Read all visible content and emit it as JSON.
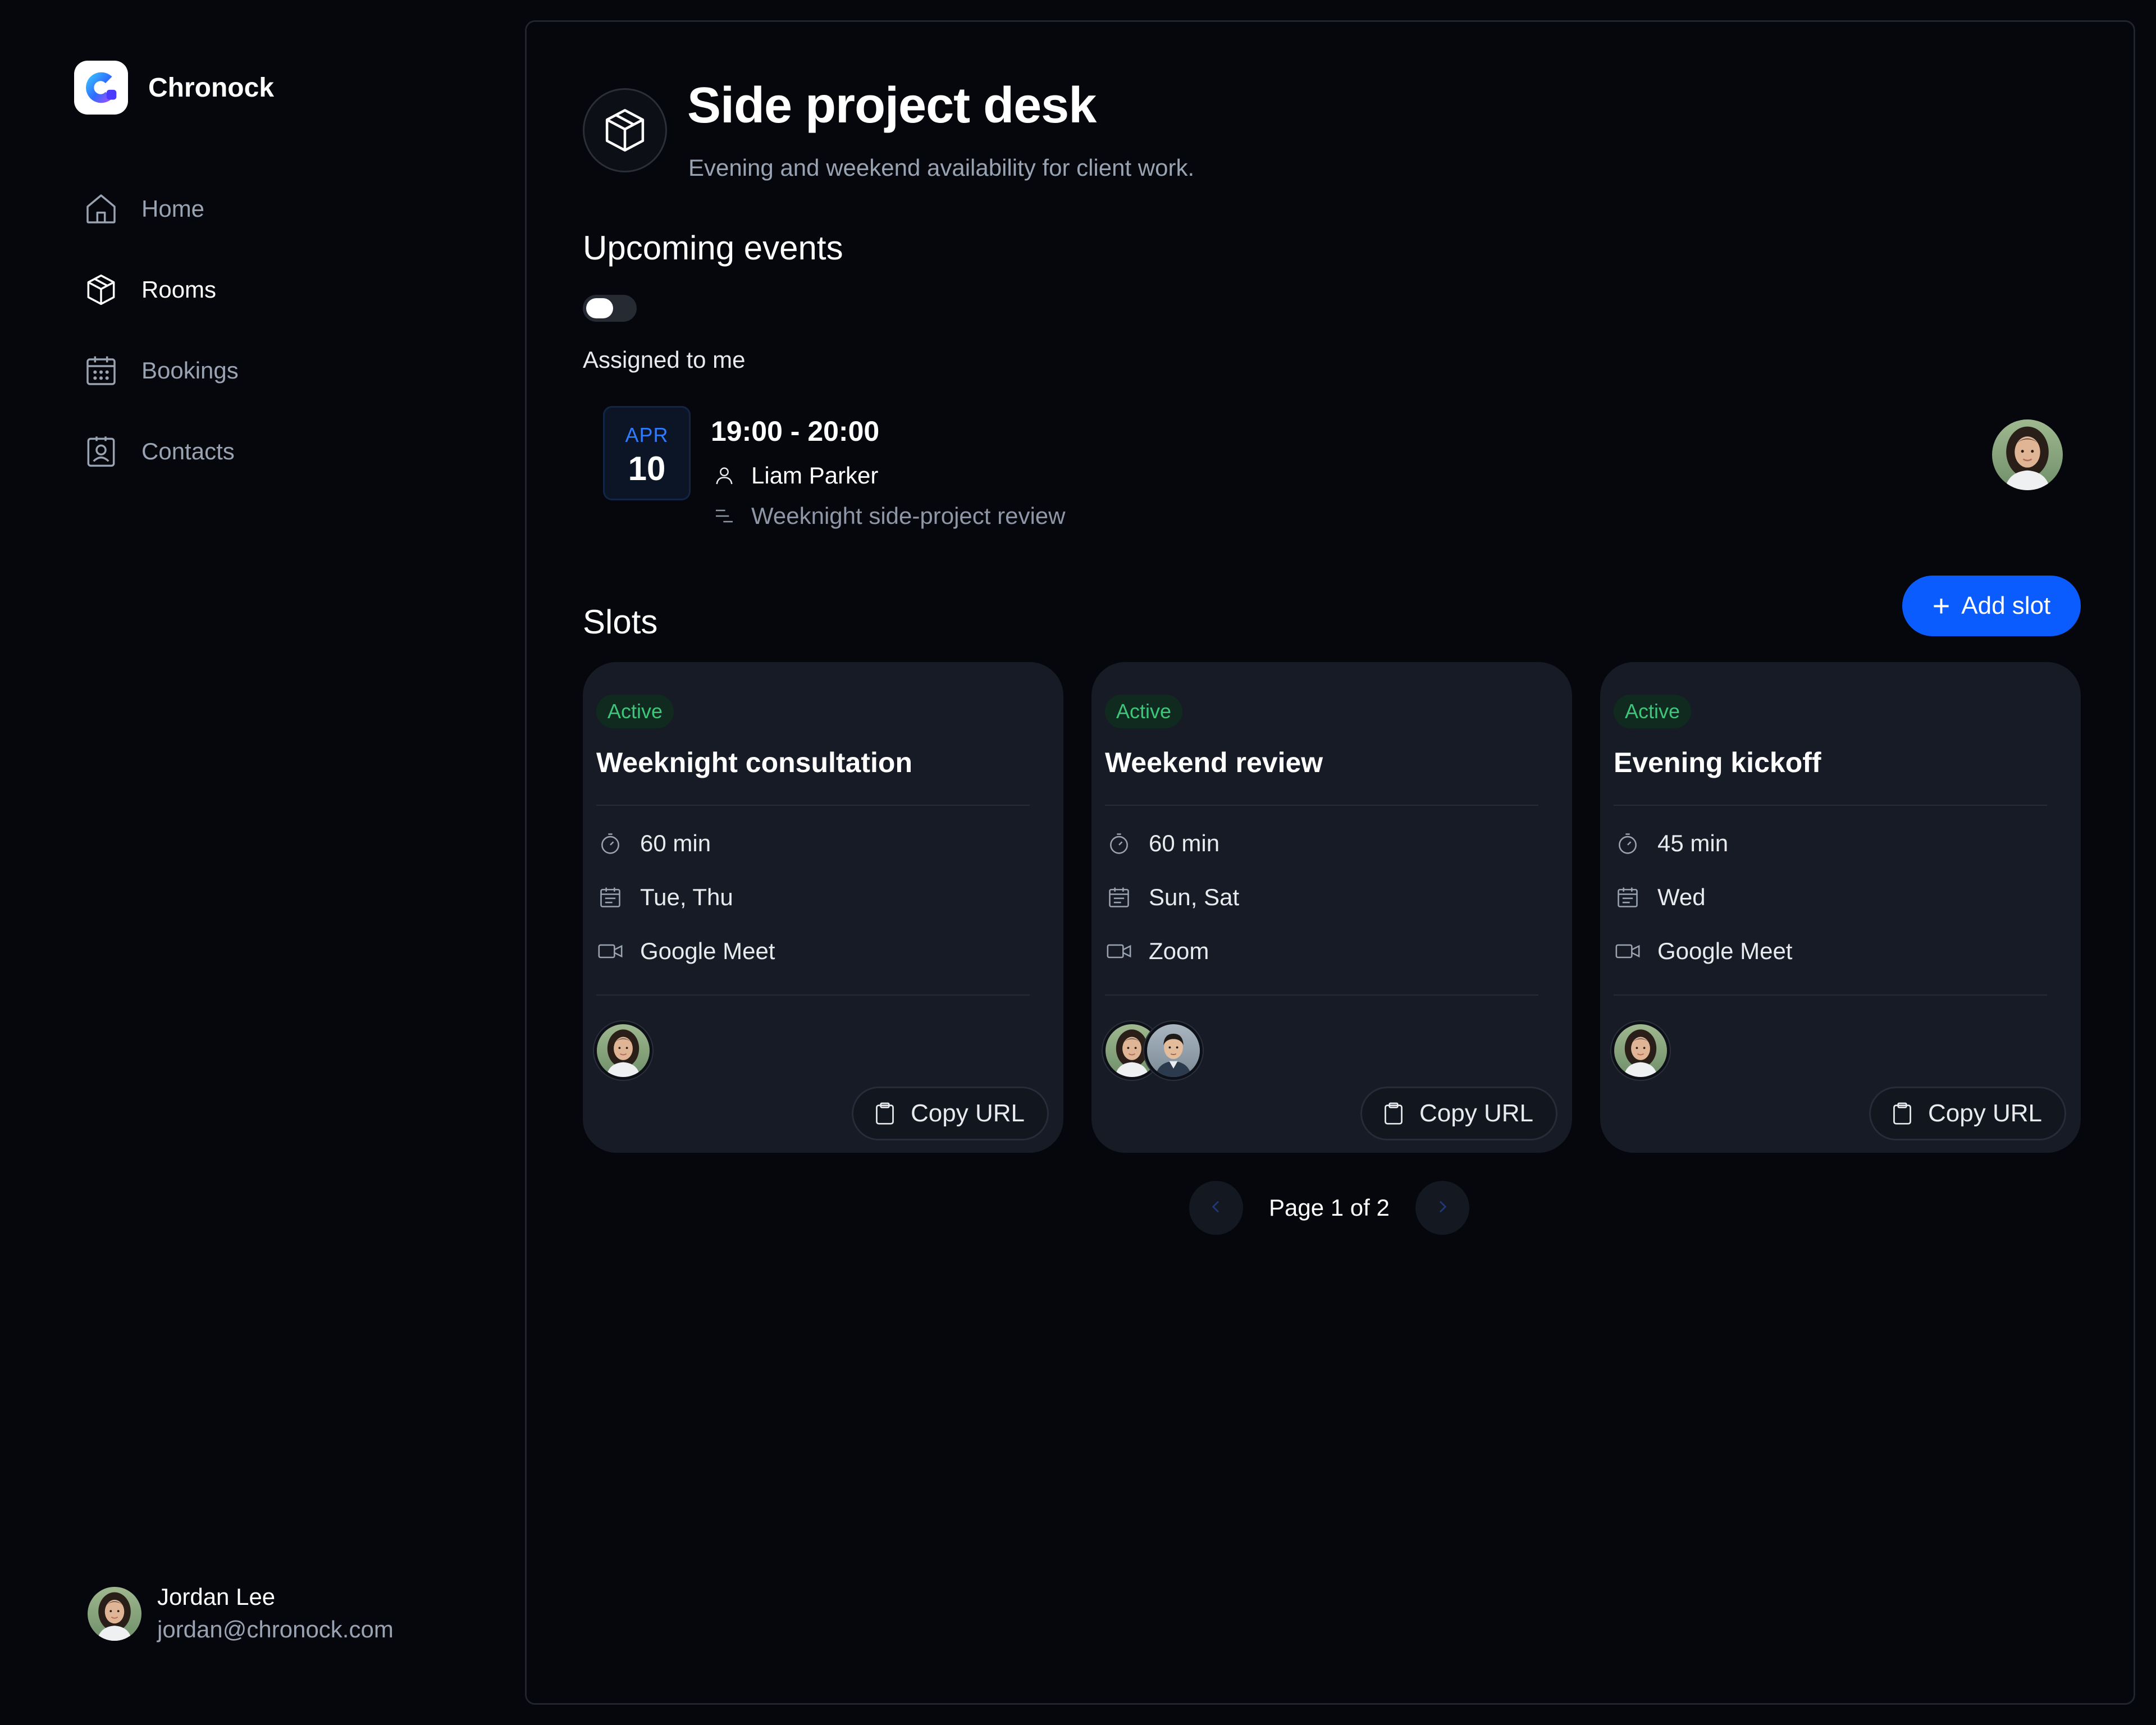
{
  "app": {
    "name": "Chronock"
  },
  "sidebar": {
    "items": [
      {
        "label": "Home",
        "icon": "home-icon",
        "active": false
      },
      {
        "label": "Rooms",
        "icon": "cube-icon",
        "active": true
      },
      {
        "label": "Bookings",
        "icon": "calendar-icon",
        "active": false
      },
      {
        "label": "Contacts",
        "icon": "contact-card-icon",
        "active": false
      }
    ],
    "user": {
      "name": "Jordan Lee",
      "email": "jordan@chronock.com"
    }
  },
  "page": {
    "title": "Side project desk",
    "subtitle": "Evening and weekend availability for client work."
  },
  "upcoming": {
    "heading": "Upcoming events",
    "toggle": {
      "label": "Assigned to me",
      "on": false
    },
    "event": {
      "month": "APR",
      "day": "10",
      "time": "19:00 - 20:00",
      "person": "Liam Parker",
      "description": "Weeknight side-project review"
    }
  },
  "slots": {
    "heading": "Slots",
    "add_label": "Add slot",
    "items": [
      {
        "status": "Active",
        "title": "Weeknight consultation",
        "duration": "60 min",
        "days": "Tue, Thu",
        "location": "Google Meet",
        "hosts": 1,
        "copy_label": "Copy URL"
      },
      {
        "status": "Active",
        "title": "Weekend review",
        "duration": "60 min",
        "days": "Sun, Sat",
        "location": "Zoom",
        "hosts": 2,
        "copy_label": "Copy URL"
      },
      {
        "status": "Active",
        "title": "Evening kickoff",
        "duration": "45 min",
        "days": "Wed",
        "location": "Google Meet",
        "hosts": 1,
        "copy_label": "Copy URL"
      }
    ]
  },
  "pagination": {
    "text": "Page 1 of 2"
  },
  "colors": {
    "background": "#05070c",
    "card": "#161b25",
    "accent": "#0a5cff",
    "active_badge_text": "#3ec57a",
    "muted_text": "#9aa3b2"
  }
}
